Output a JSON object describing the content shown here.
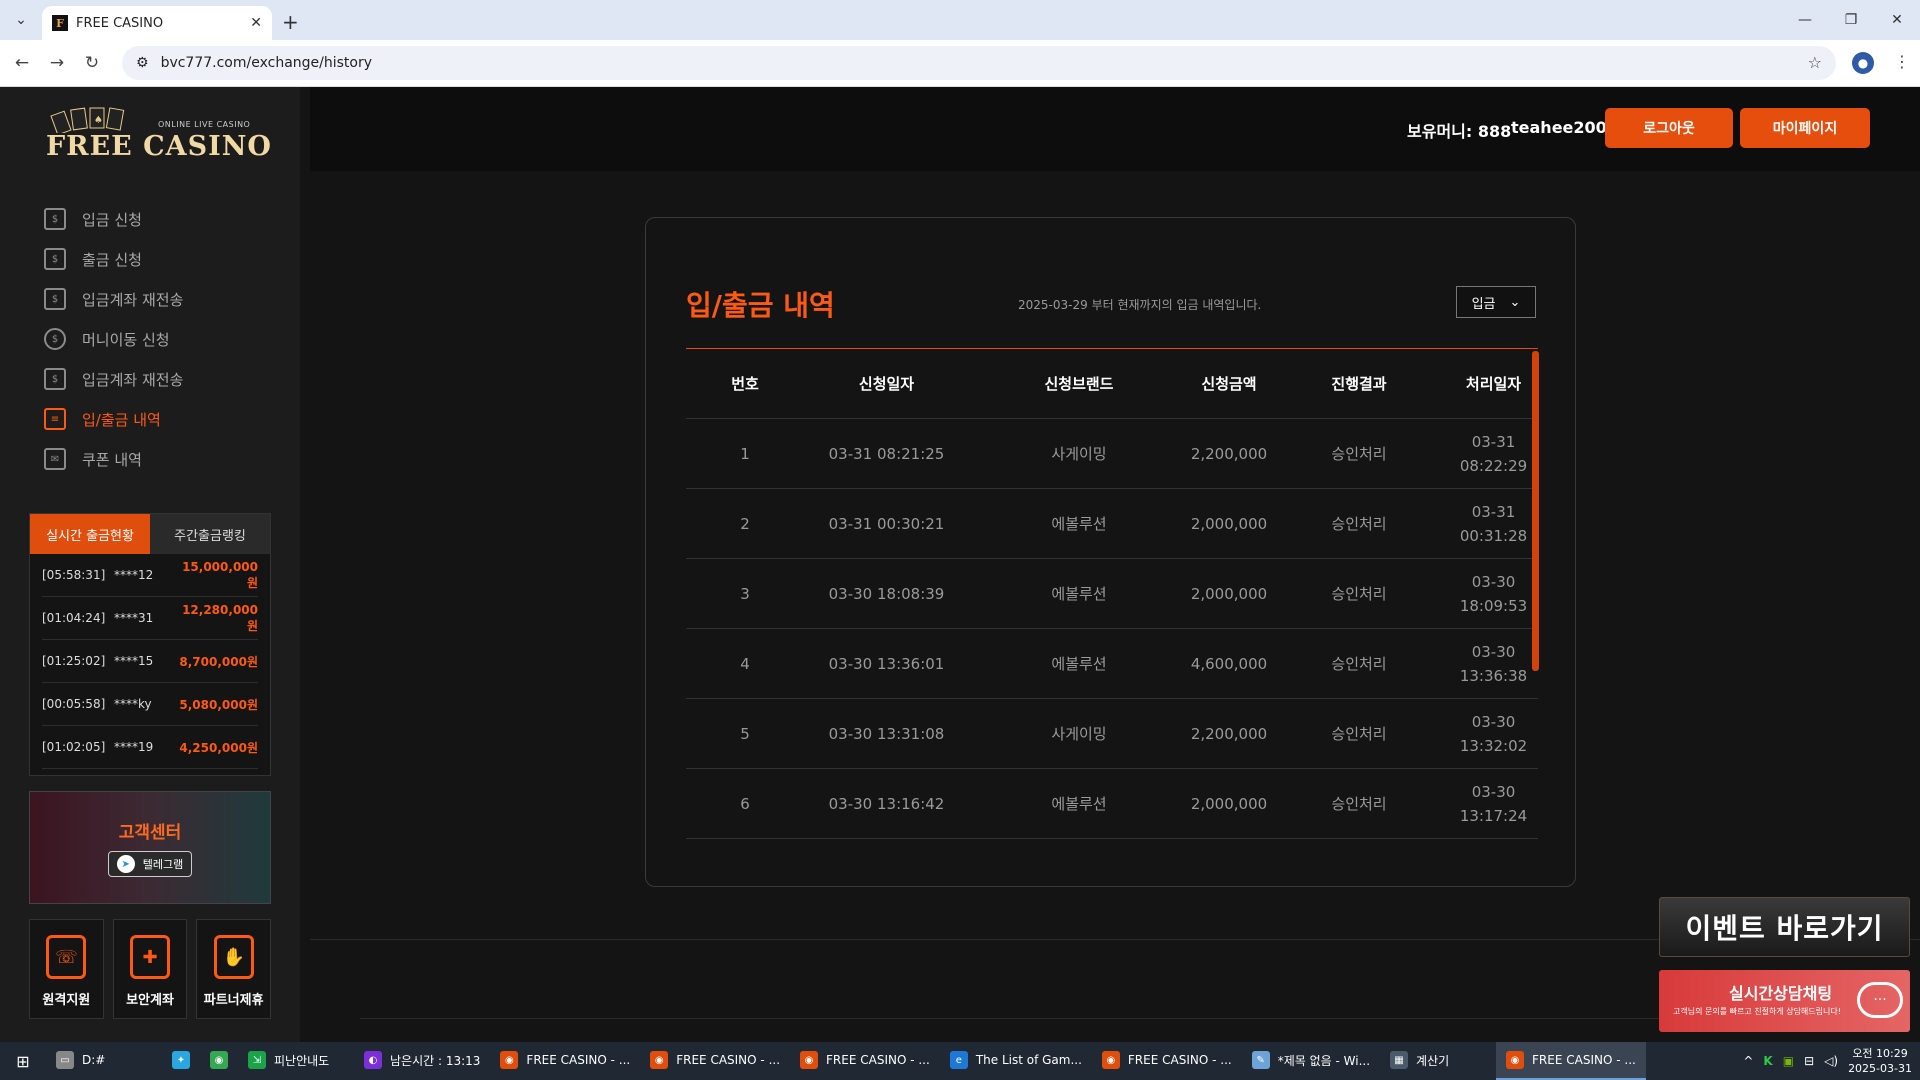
{
  "browser": {
    "tab_title": "FREE CASINO",
    "tab_favicon": "F",
    "url": "bvc777.com/exchange/history"
  },
  "site": {
    "logo_sub": "ONLINE LIVE CASINO",
    "logo_main": "FREE CASINO",
    "menu": [
      {
        "label": "입금 신청",
        "icon": "deposit-icon"
      },
      {
        "label": "출금 신청",
        "icon": "withdraw-icon"
      },
      {
        "label": "입금계좌 재전송",
        "icon": "account-resend-icon"
      },
      {
        "label": "머니이동 신청",
        "icon": "money-transfer-icon"
      },
      {
        "label": "입금계좌 재전송",
        "icon": "account-resend-icon"
      },
      {
        "label": "입/출금 내역",
        "icon": "history-icon",
        "active": true
      },
      {
        "label": "쿠폰 내역",
        "icon": "coupon-icon"
      }
    ],
    "ranking": {
      "tab_active": "실시간 출금현황",
      "tab_inactive": "주간출금랭킹",
      "rows": [
        {
          "time": "[05:58:31]",
          "user": "****12",
          "amount": "15,000,000원"
        },
        {
          "time": "[01:04:24]",
          "user": "****31",
          "amount": "12,280,000원"
        },
        {
          "time": "[01:25:02]",
          "user": "****15",
          "amount": "8,700,000원"
        },
        {
          "time": "[00:05:58]",
          "user": "****ky",
          "amount": "5,080,000원"
        },
        {
          "time": "[01:02:05]",
          "user": "****19",
          "amount": "4,250,000원"
        }
      ]
    },
    "support": {
      "title": "고객센터",
      "telegram": "텔레그램"
    },
    "quick": [
      {
        "label": "원격지원",
        "icon": "remote-support-icon"
      },
      {
        "label": "보안계좌",
        "icon": "secure-account-icon"
      },
      {
        "label": "파트너제휴",
        "icon": "partner-icon"
      }
    ],
    "header": {
      "money": "보유머니: 888",
      "username": "teahee2005",
      "logout": "로그아웃",
      "mypage": "마이페이지"
    },
    "history": {
      "title": "입/출금 내역",
      "desc": "2025-03-29 부터 현재까지의 입금 내역입니다.",
      "filter": "입금",
      "columns": [
        "번호",
        "신청일자",
        "신청브랜드",
        "신청금액",
        "진행결과",
        "처리일자"
      ],
      "rows": [
        {
          "no": "1",
          "date": "03-31 08:21:25",
          "brand": "사게이밍",
          "amount": "2,200,000",
          "status": "승인처리",
          "proc_date": "03-31",
          "proc_time": "08:22:29"
        },
        {
          "no": "2",
          "date": "03-31 00:30:21",
          "brand": "에볼루션",
          "amount": "2,000,000",
          "status": "승인처리",
          "proc_date": "03-31",
          "proc_time": "00:31:28"
        },
        {
          "no": "3",
          "date": "03-30 18:08:39",
          "brand": "에볼루션",
          "amount": "2,000,000",
          "status": "승인처리",
          "proc_date": "03-30",
          "proc_time": "18:09:53"
        },
        {
          "no": "4",
          "date": "03-30 13:36:01",
          "brand": "에볼루션",
          "amount": "4,600,000",
          "status": "승인처리",
          "proc_date": "03-30",
          "proc_time": "13:36:38"
        },
        {
          "no": "5",
          "date": "03-30 13:31:08",
          "brand": "사게이밍",
          "amount": "2,200,000",
          "status": "승인처리",
          "proc_date": "03-30",
          "proc_time": "13:32:02"
        },
        {
          "no": "6",
          "date": "03-30 13:16:42",
          "brand": "에볼루션",
          "amount": "2,000,000",
          "status": "승인처리",
          "proc_date": "03-30",
          "proc_time": "13:17:24"
        }
      ]
    },
    "event_banner": "이벤트 바로가기",
    "chat_banner": {
      "title": "실시간상담채팅",
      "sub": "고객님의 문의를 빠르고 친절하게 상담해드립니다!"
    }
  },
  "taskbar": {
    "items": [
      {
        "label": "D:#",
        "icon": "drive-icon",
        "color": "#888888"
      },
      {
        "label": "",
        "icon": "bird-icon",
        "color": "#2aa6e0"
      },
      {
        "label": "",
        "icon": "chrome-icon",
        "color": "#34a853"
      },
      {
        "label": "피난안내도",
        "icon": "exit-sign-icon",
        "color": "#1ba34a"
      },
      {
        "label": "남은시간 : 13:13",
        "icon": "timer-icon",
        "color": "#7b2fd6"
      },
      {
        "label": "FREE CASINO - ...",
        "icon": "chrome-icon",
        "color": "#e04e0e"
      },
      {
        "label": "FREE CASINO - ...",
        "icon": "chrome-icon",
        "color": "#e04e0e"
      },
      {
        "label": "FREE CASINO - ...",
        "icon": "chrome-icon",
        "color": "#e04e0e"
      },
      {
        "label": "The List of Gam...",
        "icon": "edge-icon",
        "color": "#1c7ad6"
      },
      {
        "label": "FREE CASINO - ...",
        "icon": "chrome-icon",
        "color": "#e04e0e"
      },
      {
        "label": "*제목 없음 - Wi...",
        "icon": "notepad-icon",
        "color": "#6ea3d8"
      },
      {
        "label": "계산기",
        "icon": "calculator-icon",
        "color": "#4a5a6a"
      },
      {
        "label": "FREE CASINO - ...",
        "icon": "chrome-icon",
        "color": "#e04e0e",
        "active": true
      }
    ],
    "clock_time": "오전 10:29",
    "clock_date": "2025-03-31"
  },
  "colors": {
    "accent": "#ff5a14",
    "button": "#e54e0c",
    "bg": "#141414"
  }
}
